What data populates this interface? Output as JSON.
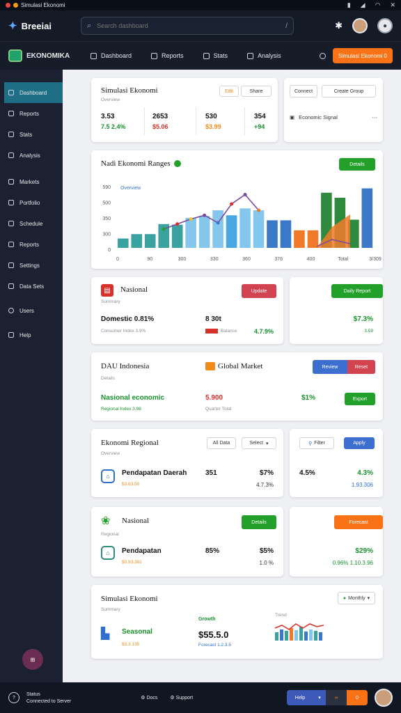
{
  "titlebar": {
    "title": "Simulasi Ekonomi"
  },
  "header": {
    "brand": "Breeiai",
    "search_placeholder": "Search dashboard",
    "search_shortcut": "/"
  },
  "nav": {
    "logo_text": "EKONOMIKA",
    "items": [
      "Dashboard",
      "Reports",
      "Stats",
      "Analysis"
    ],
    "cta_label": "Simulasi Ekonomi",
    "cta_count": "0"
  },
  "sidebar": {
    "items": [
      "Dashboard",
      "Reports",
      "Stats",
      "Analysis",
      "Markets",
      "Portfolio",
      "Schedule",
      "Reports",
      "Settings",
      "Data Sets",
      "Users",
      "Help"
    ]
  },
  "cards": {
    "simulasi": {
      "title": "Simulasi Ekonomi",
      "subtitle": "Overview",
      "tab1": "Edit",
      "tab2": "Share",
      "stats": [
        {
          "value": "3.53",
          "change": "7.5 2.4%"
        },
        {
          "value": "2653",
          "change": "$5.06"
        },
        {
          "value": "530",
          "change": "$3.99"
        },
        {
          "value": "354",
          "change": "+94"
        }
      ]
    },
    "side": {
      "btn1": "Connect",
      "btn2": "Create Group",
      "row": "Economic Signal"
    },
    "chart_card": {
      "title": "Nadi Ekonomi Ranges",
      "button": "Details"
    },
    "rows": [
      {
        "title": "Nasional",
        "sub": "Summary",
        "btn": "Update",
        "label": "Domestic 0.81%",
        "detail": "Consumer Index 3.9%",
        "value": "8 30t",
        "value_sub": "Balance",
        "right_value": "4.7.9%",
        "far_btn": "Daily Report",
        "far_value": "$7.3%",
        "far_sub": "3.59"
      },
      {
        "title": "DAU Indonesia",
        "sub": "Details",
        "title2": "Global Market",
        "btn_a": "Review",
        "btn_b": "Reset",
        "label": "Nasional economic",
        "detail": "Regional Index 3.98",
        "value": "5.900",
        "value_sub": "Quarter Total",
        "right_value": "$1%",
        "btn_c": "Export"
      },
      {
        "title": "Ekonomi Regional",
        "sub": "Overview",
        "dd1": "All Data",
        "dd2": "Select",
        "btn_a": "Filter",
        "btn_b": "Apply",
        "label": "Pendapatan Daerah",
        "detail": "$3.63.50",
        "value": "351",
        "right_value": "$7%",
        "right_sub": "4.7.3%",
        "far_value1": "4.5%",
        "far_value2": "4.3%",
        "far_sub": "1.93.306"
      },
      {
        "title": "Nasional",
        "sub": "Regional",
        "btn": "Details",
        "label": "Pendapatan",
        "detail": "$0.93.301",
        "value": "85%",
        "right_value": "$5%",
        "right_sub": "1.0 %",
        "far_btn": "Forecast",
        "far_value": "$29%",
        "far_sub": "0.96% 1.10.3.96"
      },
      {
        "title": "Simulasi Ekonomi",
        "sub": "Summary",
        "dd": "Monthly",
        "label": "Seasonal",
        "detail": "$3.3.130",
        "mid_label": "Growth",
        "value": "$55.5.0",
        "value_sub": "Forecast 1.2.3.5",
        "mini_label": "Trend"
      }
    ]
  },
  "footer": {
    "line1": "Status",
    "line2": "Connected to Server",
    "link1": "Docs",
    "link2": "Support",
    "btn1": "Help",
    "btn3": "0"
  },
  "chart_data": {
    "type": "bar",
    "title": "Nadi Ekonomi Ranges",
    "legend": [
      "Overview"
    ],
    "y_ticks": [
      "590",
      "500",
      "350",
      "300",
      "0"
    ],
    "x_ticks": [
      "0",
      "90",
      "300",
      "330",
      "360",
      "376",
      "400",
      "Total",
      "3/309"
    ],
    "values": [
      15,
      22,
      22,
      38,
      37,
      48,
      51,
      60,
      52,
      63,
      60,
      44,
      44,
      28,
      28,
      88,
      80,
      45,
      95
    ],
    "colors": [
      "#3aa3a0",
      "#3aa3a0",
      "#3aa3a0",
      "#3aa3a0",
      "#3aa3a0",
      "#85c6ec",
      "#85c6ec",
      "#85c6ec",
      "#4aa8e0",
      "#85c6ec",
      "#85c6ec",
      "#3b78c8",
      "#3b78c8",
      "#f07a2a",
      "#f07a2a",
      "#2e8b3e",
      "#2e8b3e",
      "#2e8b3e",
      "#3b78c8"
    ],
    "line": [
      null,
      null,
      null,
      30,
      38,
      46,
      52,
      40,
      70,
      85,
      60,
      null,
      null,
      null,
      null,
      null,
      null,
      null,
      null
    ],
    "ylim": [
      0,
      100
    ]
  }
}
